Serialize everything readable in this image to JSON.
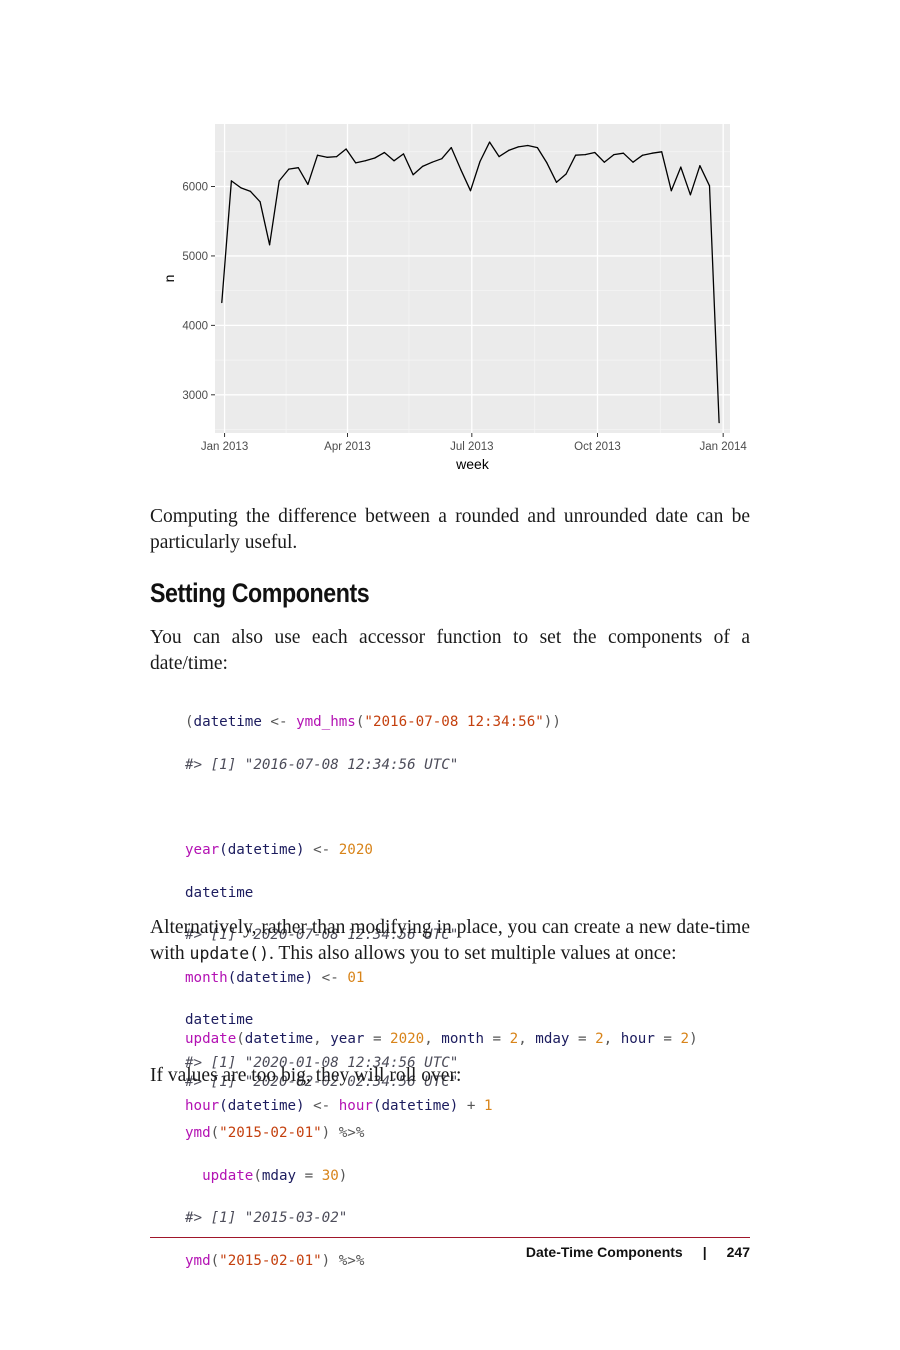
{
  "chart_data": {
    "type": "line",
    "xlabel": "week",
    "ylabel": "n",
    "x_tick_labels": [
      "Jan 2013",
      "Apr 2013",
      "Jul 2013",
      "Oct 2013",
      "Jan 2014"
    ],
    "y_tick_labels": [
      "3000",
      "4000",
      "5000",
      "6000"
    ],
    "y_ticks": [
      3000,
      4000,
      5000,
      6000
    ],
    "ylim": [
      2450,
      6900
    ],
    "xlim": [
      "2012-12-25",
      "2014-01-06"
    ],
    "grid": true,
    "line_color": "#000000",
    "panel_color": "#ebebeb",
    "x": [
      "2012-12-30",
      "2013-01-06",
      "2013-01-13",
      "2013-01-20",
      "2013-01-27",
      "2013-02-03",
      "2013-02-10",
      "2013-02-17",
      "2013-02-24",
      "2013-03-03",
      "2013-03-10",
      "2013-03-17",
      "2013-03-24",
      "2013-03-31",
      "2013-04-07",
      "2013-04-14",
      "2013-04-21",
      "2013-04-28",
      "2013-05-05",
      "2013-05-12",
      "2013-05-19",
      "2013-05-26",
      "2013-06-02",
      "2013-06-09",
      "2013-06-16",
      "2013-06-23",
      "2013-06-30",
      "2013-07-07",
      "2013-07-14",
      "2013-07-21",
      "2013-07-28",
      "2013-08-04",
      "2013-08-11",
      "2013-08-18",
      "2013-08-25",
      "2013-09-01",
      "2013-09-08",
      "2013-09-15",
      "2013-09-22",
      "2013-09-29",
      "2013-10-06",
      "2013-10-13",
      "2013-10-20",
      "2013-10-27",
      "2013-11-03",
      "2013-11-10",
      "2013-11-17",
      "2013-11-24",
      "2013-12-01",
      "2013-12-08",
      "2013-12-15",
      "2013-12-22",
      "2013-12-29"
    ],
    "values": [
      4330,
      6080,
      5980,
      5930,
      5780,
      5160,
      6080,
      6250,
      6270,
      6030,
      6450,
      6420,
      6430,
      6540,
      6340,
      6370,
      6410,
      6490,
      6370,
      6470,
      6170,
      6290,
      6350,
      6400,
      6560,
      6240,
      5940,
      6360,
      6640,
      6430,
      6520,
      6570,
      6590,
      6560,
      6340,
      6060,
      6180,
      6450,
      6460,
      6490,
      6350,
      6460,
      6480,
      6350,
      6450,
      6480,
      6500,
      5940,
      6280,
      5880,
      6300,
      6010,
      2600
    ]
  },
  "body": {
    "p1": "Computing the difference between a rounded and unrounded date can be particularly useful.",
    "heading": "Setting Components",
    "p2": "You can also use each accessor function to set the components of a date/time:",
    "p3_before": "Alternatively, rather than modifying in place, you can create a new date-time with ",
    "p3_code": "update()",
    "p3_after": ". This also allows you to set multiple values at once:",
    "p4": "If values are too big, they will roll over:"
  },
  "code1": {
    "l1_open": "(",
    "l1_var": "datetime",
    "l1_op": " <- ",
    "l1_fn": "ymd_hms",
    "l1_paren": "(",
    "l1_str": "\"2016-07-08 12:34:56\"",
    "l1_close": "))",
    "l2_cmt": "#> [1] \"2016-07-08 12:34:56 UTC\"",
    "l4_fn": "year",
    "l4_arg": "(datetime)",
    "l4_op": " <- ",
    "l4_num": "2020",
    "l5_var": "datetime",
    "l6_cmt": "#> [1] \"2020-07-08 12:34:56 UTC\"",
    "l7_fn": "month",
    "l7_arg": "(datetime)",
    "l7_op": " <- ",
    "l7_num": "01",
    "l8_var": "datetime",
    "l9_cmt": "#> [1] \"2020-01-08 12:34:56 UTC\"",
    "l10_fn": "hour",
    "l10_arg": "(datetime)",
    "l10_op": " <- ",
    "l10_fn2": "hour",
    "l10_arg2": "(datetime)",
    "l10_op2": " + ",
    "l10_num": "1"
  },
  "code2": {
    "fn": "update",
    "open": "(",
    "a1": "datetime",
    "c1": ", ",
    "k1": "year",
    "eq1": " = ",
    "v1": "2020",
    "c2": ", ",
    "k2": "month",
    "eq2": " = ",
    "v2": "2",
    "c3": ", ",
    "k3": "mday",
    "eq3": " = ",
    "v3": "2",
    "c4": ", ",
    "k4": "hour",
    "eq4": " = ",
    "v4": "2",
    "close": ")",
    "cmt": "#> [1] \"2020-02-02 02:34:56 UTC\""
  },
  "code3": {
    "l1_fn": "ymd",
    "l1_open": "(",
    "l1_str": "\"2015-02-01\"",
    "l1_close": ")",
    "l1_op": " %>%",
    "l2_indent": "  ",
    "l2_fn": "update",
    "l2_open": "(",
    "l2_k": "mday",
    "l2_eq": " = ",
    "l2_v": "30",
    "l2_close": ")",
    "l3_cmt": "#> [1] \"2015-03-02\"",
    "l4_fn": "ymd",
    "l4_open": "(",
    "l4_str": "\"2015-02-01\"",
    "l4_close": ")",
    "l4_op": " %>%"
  },
  "footer": {
    "section": "Date-Time Components",
    "separator": "|",
    "page": "247"
  }
}
